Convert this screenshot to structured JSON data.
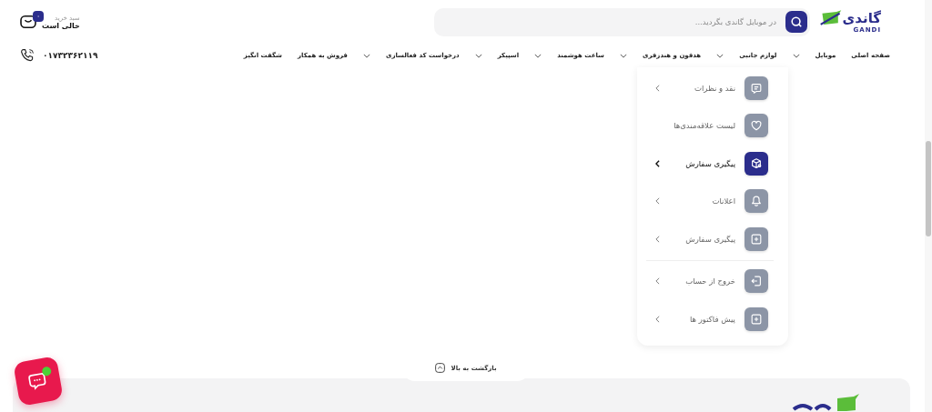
{
  "header": {
    "logo": {
      "name": "گاندی",
      "latin": "GANDI"
    },
    "search": {
      "placeholder": "در موبایل گاندی بگردید..."
    },
    "cart": {
      "title": "سبد خرید",
      "status": "خالی است",
      "count": "۰"
    }
  },
  "nav": {
    "items": [
      {
        "label": "صفحه اصلی",
        "dropdown": false
      },
      {
        "label": "موبایل",
        "dropdown": true
      },
      {
        "label": "لوازم جانبی",
        "dropdown": true
      },
      {
        "label": "هدفون و هندزفری",
        "dropdown": true
      },
      {
        "label": "ساعت هوشمند",
        "dropdown": true
      },
      {
        "label": "اسپیکر",
        "dropdown": true
      },
      {
        "label": "درخواست کد فعالسازی",
        "dropdown": true
      },
      {
        "label": "فروش به همکار",
        "dropdown": false
      },
      {
        "label": "شگفت انگیز",
        "dropdown": false
      }
    ],
    "phone": "۰۱۷۳۲۳۶۲۱۱۹"
  },
  "account_menu": {
    "items": [
      {
        "label": "نقد و نظرات",
        "selected": false,
        "chevron": true
      },
      {
        "label": "لیست علاقه‌مندی‌ها",
        "selected": false,
        "chevron": false
      },
      {
        "label": "پیگیری سفارش",
        "selected": true,
        "chevron": true
      },
      {
        "label": "اعلانات",
        "selected": false,
        "chevron": true
      },
      {
        "label": "پیگیری سفارش",
        "selected": false,
        "chevron": true
      },
      {
        "label": "خروج از حساب",
        "selected": false,
        "chevron": true,
        "divider_before": true
      },
      {
        "label": "پیش فاکتور ها",
        "selected": false,
        "chevron": true
      }
    ]
  },
  "back_to_top": {
    "label": "بازگشت به بالا"
  }
}
